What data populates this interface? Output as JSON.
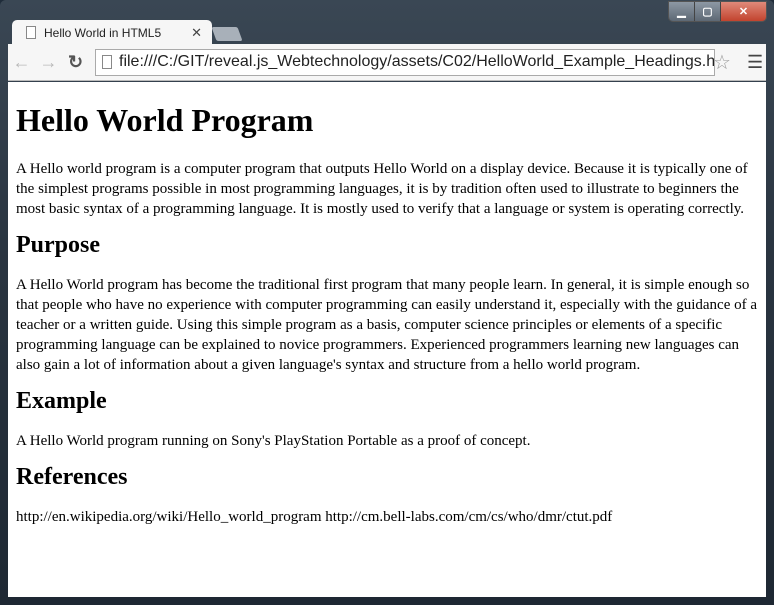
{
  "browser": {
    "tab_title": "Hello World in HTML5",
    "url": "file:///C:/GIT/reveal.js_Webtechnology/assets/C02/HelloWorld_Example_Headings.h",
    "icons": [
      "back-icon",
      "forward-icon",
      "reload-icon",
      "page-icon",
      "star-icon",
      "menu-icon",
      "close-icon",
      "minimize-icon",
      "maximize-icon"
    ]
  },
  "page": {
    "h1": "Hello World Program",
    "p1": "A Hello world program is a computer program that outputs Hello World on a display device. Because it is typically one of the simplest programs possible in most programming languages, it is by tradition often used to illustrate to beginners the most basic syntax of a programming language. It is mostly used to verify that a language or system is operating correctly.",
    "h2_purpose": "Purpose",
    "p2": "A Hello World program has become the traditional first program that many people learn. In general, it is simple enough so that people who have no experience with computer programming can easily understand it, especially with the guidance of a teacher or a written guide. Using this simple program as a basis, computer science principles or elements of a specific programming language can be explained to novice programmers. Experienced programmers learning new languages can also gain a lot of information about a given language's syntax and structure from a hello world program.",
    "h2_example": "Example",
    "p3": "A Hello World program running on Sony's PlayStation Portable as a proof of concept.",
    "h2_refs": "References",
    "p4": "http://en.wikipedia.org/wiki/Hello_world_program http://cm.bell-labs.com/cm/cs/who/dmr/ctut.pdf"
  }
}
